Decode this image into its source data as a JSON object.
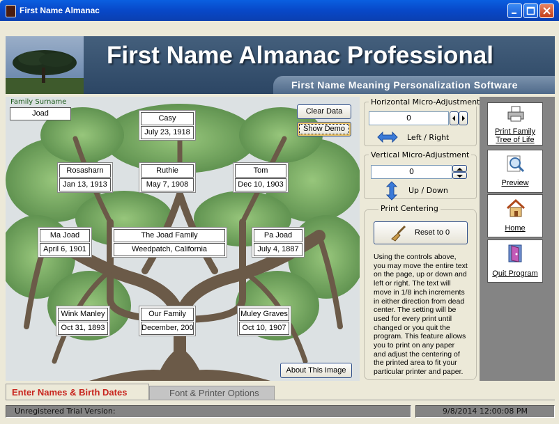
{
  "window": {
    "title": "First Name Almanac"
  },
  "banner": {
    "title": "First Name Almanac Professional",
    "subtitle": "First Name Meaning Personalization Software"
  },
  "tree": {
    "surname_label": "Family Surname",
    "surname": "Joad",
    "clear_label": "Clear Data",
    "demo_label": "Show Demo",
    "about_label": "About This Image",
    "people": [
      {
        "name": "Casy",
        "date": "July 23, 1918"
      },
      {
        "name": "Rosasharn",
        "date": "Jan 13, 1913"
      },
      {
        "name": "Ruthie",
        "date": "May 7, 1908"
      },
      {
        "name": "Tom",
        "date": "Dec 10, 1903"
      },
      {
        "name": "Ma Joad",
        "date": "April 6, 1901"
      },
      {
        "name": "The Joad Family",
        "date": "Weedpatch, California"
      },
      {
        "name": "Pa Joad",
        "date": "July 4, 1887"
      },
      {
        "name": "Wink Manley",
        "date": "Oct 31, 1893"
      },
      {
        "name": "Our Family",
        "date": "December, 200"
      },
      {
        "name": "Muley Graves",
        "date": "Oct 10, 1907"
      }
    ]
  },
  "controls": {
    "horizontal_label": "Horizontal Micro-Adjustment",
    "horizontal_value": "0",
    "horizontal_hint": "Left / Right",
    "vertical_label": "Vertical Micro-Adjustment",
    "vertical_value": "0",
    "vertical_hint": "Up / Down",
    "centering_label": "Print Centering",
    "reset_label": "Reset to 0",
    "help_lines": [
      "Using the controls above,",
      "you may move the entire text",
      "on the page, up or down and",
      "left or right. The text will",
      "move in 1/8 inch increments",
      "in either direction from dead",
      "center. The setting will be",
      "used for every print until",
      "changed or you quit the",
      "program.  This feature allows",
      "you to print on any paper",
      "and adjust the centering of",
      "the printed area to fit your",
      "particular printer and paper."
    ]
  },
  "nav": {
    "print": {
      "line1": "Print Family",
      "line2": "Tree of Life",
      "icon": "printer-icon"
    },
    "preview": {
      "label": "Preview",
      "icon": "magnifier-icon"
    },
    "home": {
      "label": "Home",
      "icon": "house-icon"
    },
    "quit": {
      "label": "Quit Program",
      "icon": "door-icon"
    }
  },
  "tabs": [
    "Enter Names & Birth Dates",
    "Font & Printer Options"
  ],
  "status": {
    "left": "Unregistered Trial Version:",
    "right": "9/8/2014 12:00:08 PM"
  },
  "colors": {
    "titlebar": "#0a5fe0",
    "banner": "#3a5574",
    "tab_active_text": "#c8241d",
    "nav_panel": "#848484"
  }
}
